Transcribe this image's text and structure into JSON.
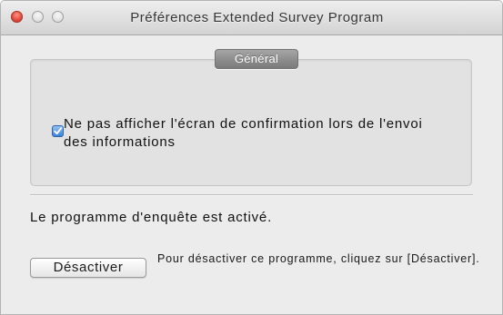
{
  "window": {
    "title": "Préférences Extended Survey Program",
    "controls": {
      "close": "close-icon",
      "minimize": "minimize-icon",
      "zoom": "zoom-icon"
    }
  },
  "general_group": {
    "label": "Général",
    "checkbox": {
      "label": "Ne pas afficher l'écran de confirmation lors de l'envoi des informations",
      "checked": true,
      "icon": "checkmark-icon"
    }
  },
  "status": {
    "text": "Le programme d'enquête est activé."
  },
  "deactivate": {
    "button_label": "Désactiver",
    "hint": "Pour désactiver ce programme, cliquez sur [Désactiver]."
  },
  "colors": {
    "close_red": "#e0463b",
    "checkbox_blue": "#3b80d8",
    "tab_gray": "#8a8a8a",
    "window_bg": "#ececec"
  }
}
